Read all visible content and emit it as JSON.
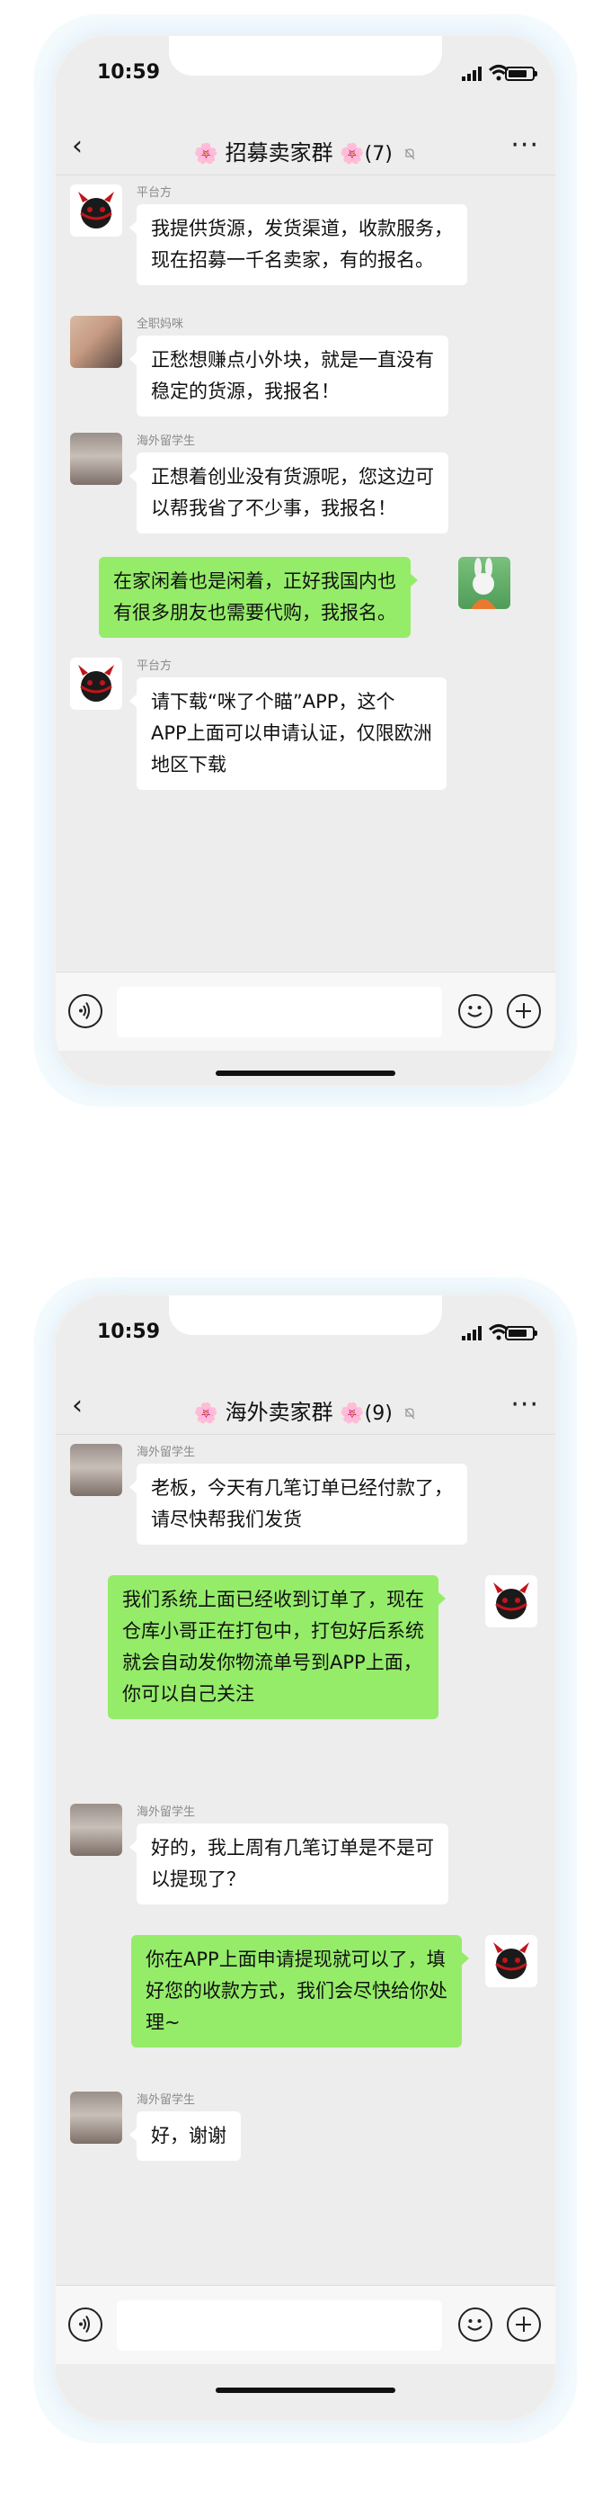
{
  "status_time": "10:59",
  "colors": {
    "my_bubble": "#95ec69",
    "other_bubble": "#ffffff",
    "chat_bg": "#ededed"
  },
  "screens": [
    {
      "title": {
        "flower_left": "🌸",
        "name": "招募卖家群",
        "flower_right": "🌸",
        "count": "(7)"
      },
      "messages": [
        {
          "sender": "平台方",
          "avatar": "devil-logo-avatar",
          "side": "left",
          "lines": [
            "我提供货源，发货渠道，收款服务，",
            "现在招募一千名卖家，有的报名。"
          ]
        },
        {
          "sender": "全职妈咪",
          "avatar": "couple-photo-avatar",
          "side": "left",
          "lines": [
            "正愁想赚点小外块，就是一直没有",
            "稳定的货源，我报名！"
          ]
        },
        {
          "sender": "海外留学生",
          "avatar": "student-photo-avatar",
          "side": "left",
          "lines": [
            "正想着创业没有货源呢，您这边可",
            "以帮我省了不少事，我报名！"
          ]
        },
        {
          "sender": "",
          "avatar": "bunny-avatar",
          "side": "right",
          "lines": [
            "在家闲着也是闲着，正好我国内也",
            "有很多朋友也需要代购，我报名。"
          ]
        },
        {
          "sender": "平台方",
          "avatar": "devil-logo-avatar",
          "side": "left",
          "lines": [
            "请下载“咪了个瞄”APP，这个",
            "APP上面可以申请认证，仅限欧洲",
            "地区下载"
          ]
        }
      ]
    },
    {
      "title": {
        "flower_left": "🌸",
        "name": "海外卖家群",
        "flower_right": "🌸",
        "count": "(9)"
      },
      "messages": [
        {
          "sender": "海外留学生",
          "avatar": "student-photo-avatar",
          "side": "left",
          "lines": [
            "老板，今天有几笔订单已经付款了，",
            "请尽快帮我们发货"
          ]
        },
        {
          "sender": "",
          "avatar": "devil-logo-avatar",
          "side": "right",
          "lines": [
            "我们系统上面已经收到订单了，现在",
            "仓库小哥正在打包中，打包好后系统",
            "就会自动发你物流单号到APP上面，",
            "你可以自己关注"
          ]
        },
        {
          "sender": "海外留学生",
          "avatar": "student-photo-avatar",
          "side": "left",
          "lines": [
            "好的，我上周有几笔订单是不是可",
            "以提现了？"
          ]
        },
        {
          "sender": "",
          "avatar": "devil-logo-avatar",
          "side": "right",
          "lines": [
            "你在APP上面申请提现就可以了，填",
            "好您的收款方式，我们会尽快给你处",
            "理~"
          ]
        },
        {
          "sender": "海外留学生",
          "avatar": "student-photo-avatar",
          "side": "left",
          "lines": [
            "好，谢谢"
          ]
        }
      ]
    }
  ]
}
